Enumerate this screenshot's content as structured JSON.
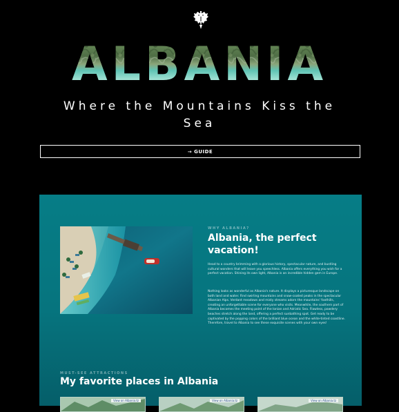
{
  "hero": {
    "title": "ALBANIA",
    "tagline": "Where the Mountains Kiss the Sea",
    "guide_button": "→ GUIDE",
    "emblem_icon": "albanian-eagle-icon"
  },
  "why": {
    "eyebrow": "WHY ALBANIA?",
    "title": "Albania, the perfect vacation!",
    "paragraph1": "Head to a country brimming with a glorious history, spectacular nature, and bustling cultural wonders that will leave you speechless. Albania offers everything you wish for a perfect vacation. Shining its own light, Albania is an incredible hidden gem in Europe.",
    "paragraph2": "Nothing looks as wonderful as Albania's nature. It displays a picturesque landscape on both land and water. Find swirling mountains and snow-coated peaks in the spectacular Albanian Alps. Verdant meadows and misty streams adorn the mountains' foothills, creating an unforgettable scene for everyone who visits. Meanwhile, the southern part of Albania becomes the meeting point of the Ionian and Adriatic Sea. Flawless, powdery beaches stretch along the land, offering a perfect sunbathing spot. Get ready to be captivated by the popping colors of the brilliant blue ocean and the white-tinted coastline. Therefore, travel to Albania to see these exquisite scenes with your own eyes!"
  },
  "attractions": {
    "eyebrow": "MUST-SEE ATTRACTIONS",
    "title": "My favorite places in Albania",
    "cards": [
      {
        "tag": "View on Albania.tz"
      },
      {
        "tag": "View on Albania.tz"
      },
      {
        "tag": "View on Albania.tz"
      }
    ]
  },
  "colors": {
    "background": "#000000",
    "panel": "#067d86",
    "text": "#ffffff"
  }
}
